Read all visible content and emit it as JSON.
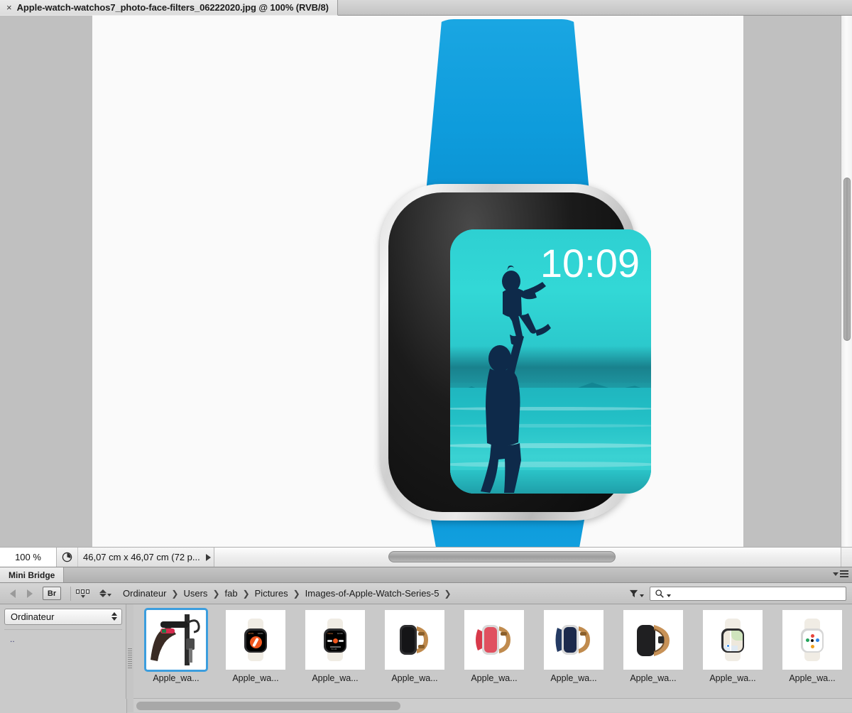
{
  "window": {
    "document_tab": {
      "close_label": "×",
      "title": "Apple-watch-watchos7_photo-face-filters_06222020.jpg @ 100% (RVB/8)"
    }
  },
  "status_bar": {
    "zoom_value": "100 %",
    "doc_size_icon": "document-size-icon",
    "doc_size_text": "46,07 cm x 46,07 cm (72 p...",
    "expand_arrow": "▶"
  },
  "canvas": {
    "watch": {
      "time": "10:09",
      "band_color": "#0e9cdc",
      "case_color": "#dedede",
      "screen_tint": "#2ed0d2",
      "silhouette_color": "#0e2a4a"
    }
  },
  "mini_bridge": {
    "panel_title": "Mini Bridge",
    "panel_menu_icon": "panel-menu-icon",
    "nav": {
      "back_icon": "back-arrow-icon",
      "forward_icon": "forward-arrow-icon",
      "bridge_button": "Br",
      "view_icon": "grid-view-icon",
      "sort_icon": "sort-icon",
      "filter_icon": "filter-funnel-icon",
      "search_icon": "search-icon",
      "search_value": "",
      "search_placeholder": ""
    },
    "breadcrumb": [
      "Ordinateur",
      "Users",
      "fab",
      "Pictures",
      "Images-of-Apple-Watch-Series-5"
    ],
    "breadcrumb_separator": "❯",
    "sidebar": {
      "select_value": "Ordinateur",
      "list_items": [
        ".."
      ]
    },
    "thumbnails": [
      {
        "label": "Apple_wa...",
        "selected": true,
        "art": "arm-handlebar"
      },
      {
        "label": "Apple_wa...",
        "selected": false,
        "art": "watch-compass"
      },
      {
        "label": "Apple_wa...",
        "selected": false,
        "art": "watch-noise"
      },
      {
        "label": "Apple_wa...",
        "selected": false,
        "art": "watch-hermes-black"
      },
      {
        "label": "Apple_wa...",
        "selected": false,
        "art": "watch-hermes-red"
      },
      {
        "label": "Apple_wa...",
        "selected": false,
        "art": "watch-hermes-blue"
      },
      {
        "label": "Apple_wa...",
        "selected": false,
        "art": "watch-leather-black"
      },
      {
        "label": "Apple_wa...",
        "selected": false,
        "art": "watch-maps"
      },
      {
        "label": "Apple_wa...",
        "selected": false,
        "art": "watch-colorful"
      }
    ],
    "selection_color": "#3c9ede"
  }
}
